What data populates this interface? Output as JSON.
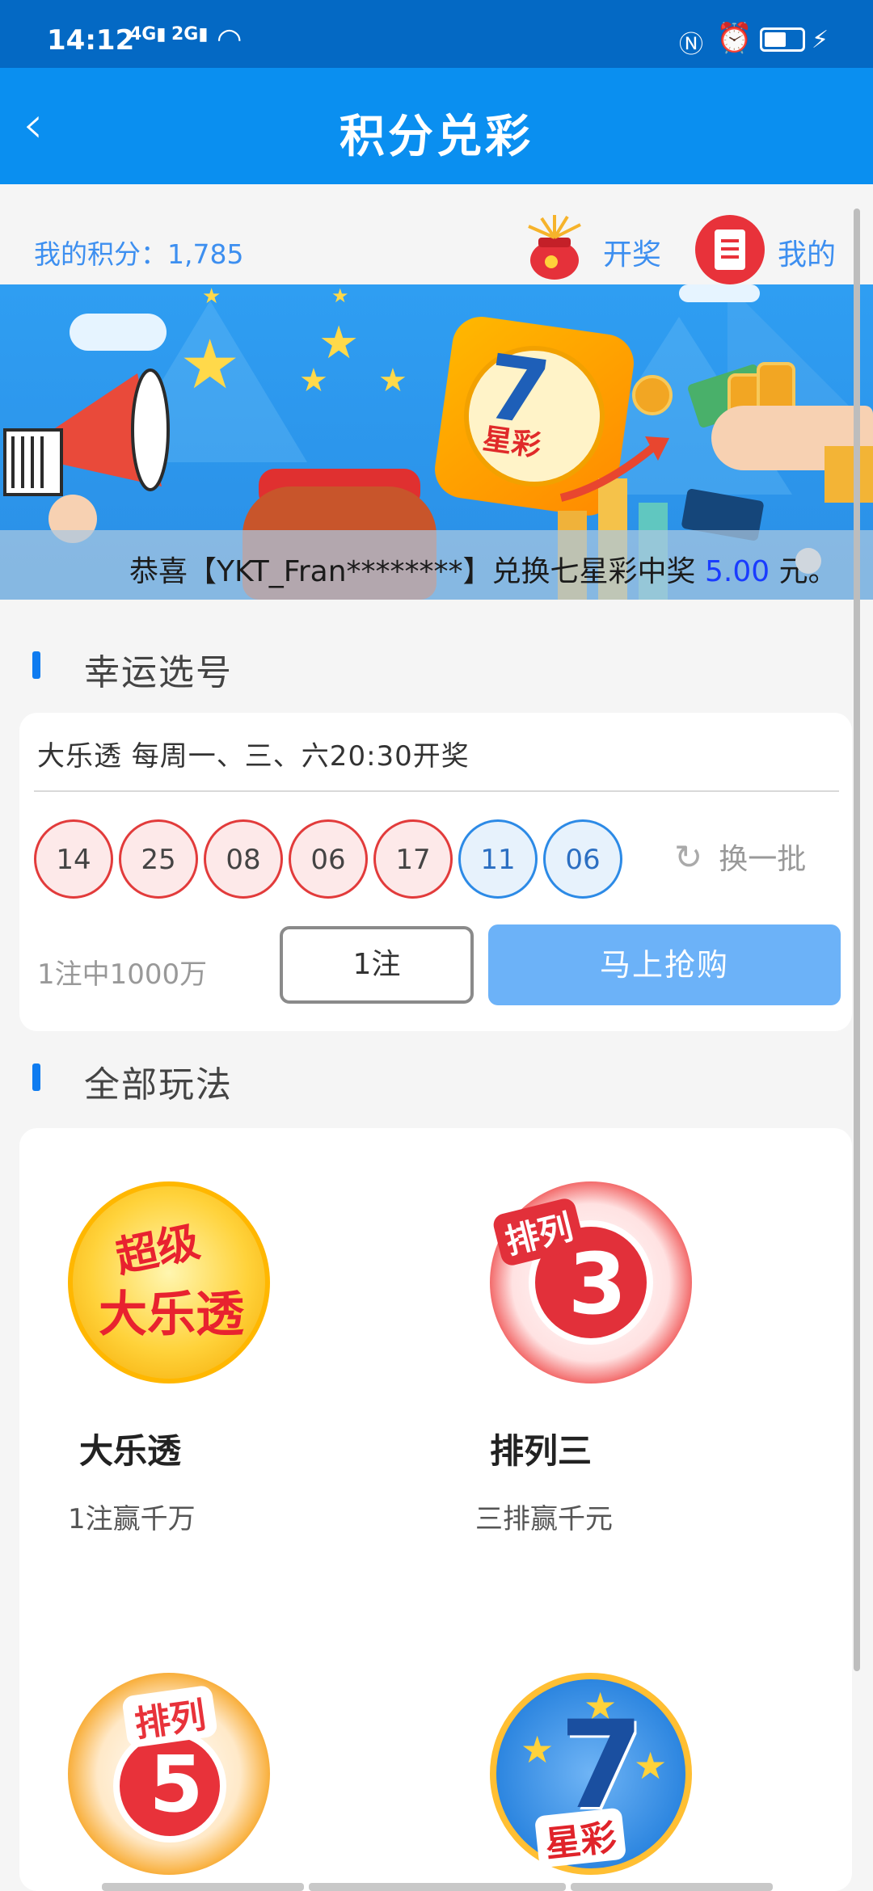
{
  "status_bar": {
    "time": "14:12",
    "signal1": "4G",
    "signal2": "2G",
    "battery_level": 0.6
  },
  "header": {
    "back_icon": "chevron-left-icon",
    "title": "积分兑彩"
  },
  "points": {
    "label": "我的积分：",
    "value": "1,785",
    "lottery_link": "开奖",
    "mine_link": "我的"
  },
  "banner": {
    "ticker_prefix": "恭喜【YKT_Fran********】兑换七星彩中奖",
    "ticker_amount": "5.00",
    "ticker_suffix": "元。",
    "app_logo_number": "7",
    "app_logo_text": "星彩"
  },
  "lucky": {
    "section_title": "幸运选号",
    "info": "大乐透 每周一、三、六20:30开奖",
    "red_balls": [
      "14",
      "25",
      "08",
      "06",
      "17"
    ],
    "blue_balls": [
      "11",
      "06"
    ],
    "refresh_label": "换一批",
    "prize_text": "1注中1000万",
    "bet_count": "1注",
    "buy_label": "马上抢购"
  },
  "all_games": {
    "section_title": "全部玩法",
    "games": [
      {
        "name": "大乐透",
        "desc": "1注赢千万",
        "logo_line1": "超级",
        "logo_line2": "大乐透"
      },
      {
        "name": "排列三",
        "desc": "三排赢千元",
        "logo_tag": "排列",
        "logo_num": "3"
      },
      {
        "logo_tag": "排列",
        "logo_num": "5"
      },
      {
        "logo_num": "7",
        "logo_text": "星彩"
      }
    ]
  },
  "colors": {
    "status_bar": "#0469c4",
    "header": "#0a8ff0",
    "accent": "#3d8ff0",
    "red_ball": "#e23b3b",
    "blue_ball": "#2c8ae6",
    "buy_button": "#6cb2f8"
  }
}
